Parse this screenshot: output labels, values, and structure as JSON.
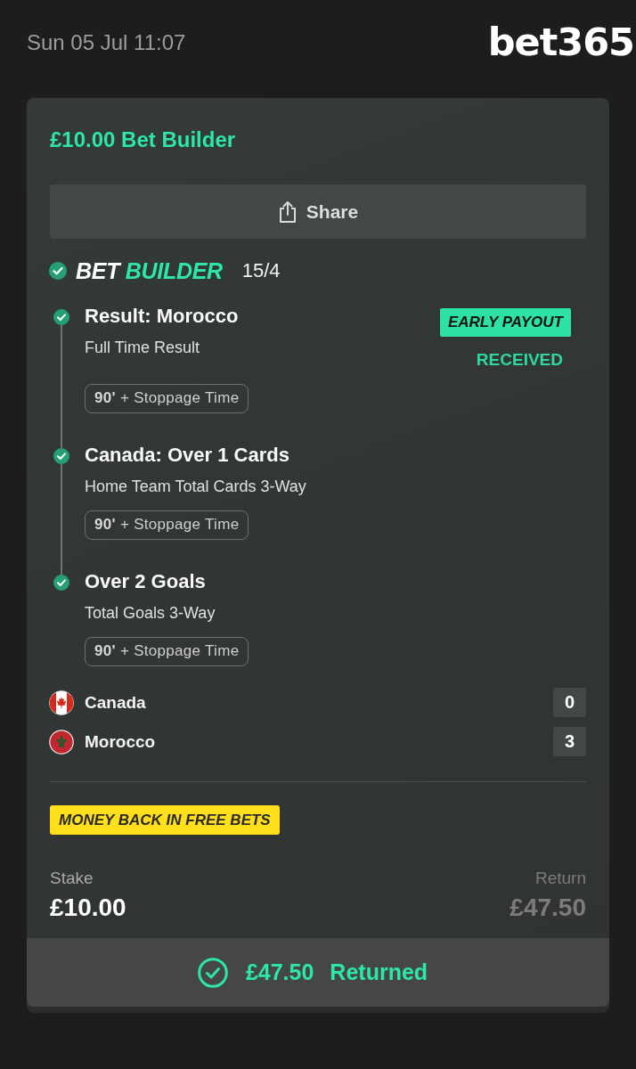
{
  "header": {
    "date": "Sun 05 Jul 11:07",
    "logo": "bet365"
  },
  "bet": {
    "title": "£10.00 Bet Builder",
    "share_button": "Share",
    "builder": {
      "won": true,
      "type": {
        "prefix": "BET",
        "highlight": "BUILDER"
      },
      "odds": "15/4"
    },
    "selections": [
      {
        "won": true,
        "title": "Result: Morocco",
        "market": "Full Time Result",
        "early_payout": {
          "badge": "EARLY PAYOUT",
          "status": "RECEIVED"
        },
        "period": "**90'** + Stoppage Time"
      },
      {
        "won": true,
        "title": "Canada: Over 1 Cards",
        "market": "Home Team Total Cards 3-Way",
        "period": "**90'** + Stoppage Time"
      },
      {
        "won": true,
        "title": "Over 2 Goals",
        "market": "Total Goals 3-Way",
        "period": "**90'** + Stoppage Time"
      }
    ],
    "teams": [
      {
        "name": "Canada",
        "score": "0"
      },
      {
        "name": "Morocco",
        "score": "3"
      }
    ],
    "promo": "MONEY BACK IN FREE BETS",
    "stake": {
      "label": "Stake",
      "value": "£10.00"
    },
    "return": {
      "label": "Return",
      "value": "£47.50"
    },
    "result": {
      "amount": "£47.50",
      "label": "Returned"
    }
  }
}
